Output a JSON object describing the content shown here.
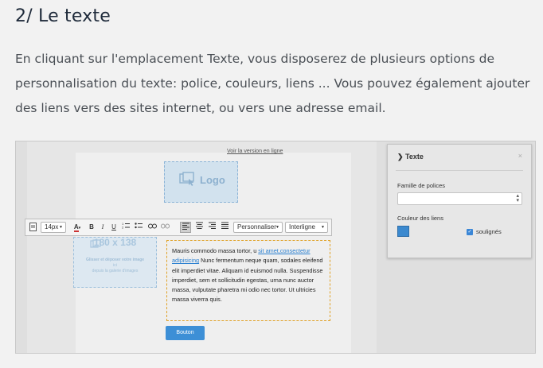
{
  "heading": "2/ Le texte",
  "paragraph": "En cliquant sur l'emplacement Texte, vous disposerez de plusieurs options de personnalisation du texte: police, couleurs, liens ... Vous pouvez également ajouter des liens vers des sites internet, ou vers une adresse email.",
  "screenshot": {
    "top_link": "Voir la version en ligne",
    "logo_label": "Logo",
    "image_placeholder": {
      "dimensions": "180 x 138",
      "line1": "Glisser et déposer votre image",
      "line2": "ici",
      "line3": "depuis la galerie d'images"
    },
    "toolbar": {
      "font_size": "14px",
      "bold": "B",
      "italic": "I",
      "underline": "U",
      "customize_label": "Personnaliser",
      "line_height_label": "Interligne"
    },
    "text_block": {
      "before_link": "Mauris commodo massa tortor, u ",
      "link": "sit amet,consectetur adipisicing",
      "after_link": " Nunc fermentum neque quam, sodales eleifend elit imperdiet vitae. Aliquam id euismod nulla. Suspendisse imperdiet, sem et sollicitudin egestas, urna nunc auctor massa, vulputate pharetra mi odio nec tortor. Ut ultricies massa viverra quis."
    },
    "button_label": "Bouton",
    "panel": {
      "title": "Texte",
      "close": "×",
      "font_family_label": "Famille de polices",
      "font_family_value": "",
      "link_color_label": "Couleur des liens",
      "link_color": "#3b89cf",
      "underlined_label": "soulignés",
      "underlined_checked": true
    }
  }
}
